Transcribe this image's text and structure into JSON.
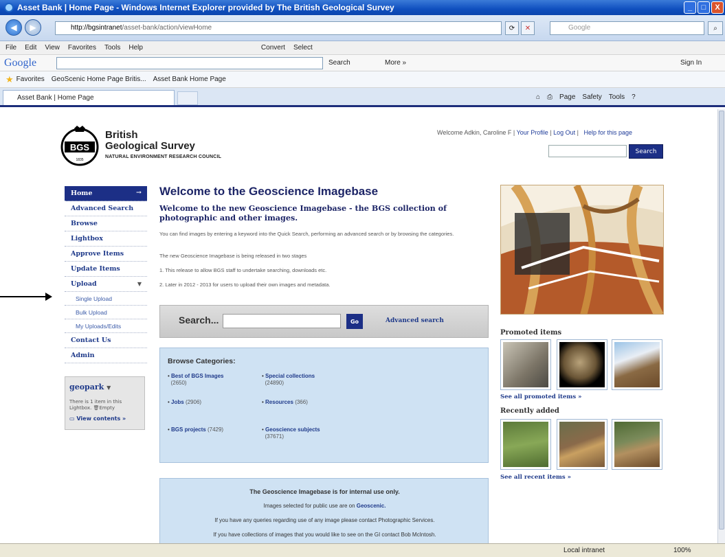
{
  "window": {
    "title": "Asset Bank | Home Page - Windows Internet Explorer provided by The British Geological Survey",
    "buttons": [
      "_",
      "□",
      "X"
    ]
  },
  "address": {
    "url_host": "http://bgsintranet",
    "url_path": "/asset-bank/action/viewHome",
    "search_placeholder": "Google"
  },
  "menu": [
    "File",
    "Edit",
    "View",
    "Favorites",
    "Tools",
    "Help"
  ],
  "menu_extra": [
    "Convert",
    "Select"
  ],
  "google_toolbar": {
    "logo": "Google",
    "search_label": "Search",
    "more_label": "More »",
    "sign_in": "Sign In"
  },
  "favorites": {
    "label": "Favorites",
    "items": [
      "GeoScenic Home Page Britis...",
      "Asset Bank Home Page"
    ]
  },
  "tab": {
    "title": "Asset Bank | Home Page",
    "commands": [
      "Page",
      "Safety",
      "Tools"
    ]
  },
  "header": {
    "brand_line1": "British",
    "brand_line2": "Geological Survey",
    "brand_line3": "NATURAL ENVIRONMENT RESEARCH COUNCIL",
    "logo_text": "BGS",
    "logo_year": "1835",
    "welcome": "Welcome Adkin, Caroline F",
    "your_profile": "Your Profile",
    "log_out": "Log Out",
    "help": "Help for this page",
    "search_button": "Search"
  },
  "nav": {
    "items": [
      {
        "label": "Home",
        "type": "active"
      },
      {
        "label": "Advanced Search",
        "type": "item"
      },
      {
        "label": "Browse",
        "type": "item"
      },
      {
        "label": "Lightbox",
        "type": "item"
      },
      {
        "label": "Approve Items",
        "type": "item"
      },
      {
        "label": "Update Items",
        "type": "item"
      },
      {
        "label": "Upload",
        "type": "item"
      },
      {
        "label": "Single Upload",
        "type": "sub"
      },
      {
        "label": "Bulk Upload",
        "type": "sub"
      },
      {
        "label": "My Uploads/Edits",
        "type": "sub"
      },
      {
        "label": "Contact Us",
        "type": "item"
      },
      {
        "label": "Admin",
        "type": "item"
      }
    ]
  },
  "lightbox": {
    "title": "geopark",
    "text": "There is 1 item in this Lightbox.",
    "empty": "Empty",
    "view": "View contents »"
  },
  "main": {
    "title": "Welcome to the Geoscience Imagebase",
    "subtitle": "Welcome to the new Geoscience Imagebase - the BGS collection of photographic and other images.",
    "para1": "You can find images by entering a keyword into the Quick Search, performing an advanced search or by browsing the categories.",
    "para2": "The new Geoscience Imagebase is being released in two stages",
    "para3": "1. This release to allow BGS staff to undertake searching, downloads etc.",
    "para4": "2. Later in 2012 - 2013 for users to upload their own images and metadata."
  },
  "search": {
    "label": "Search...",
    "go": "Go",
    "advanced": "Advanced search"
  },
  "categories": {
    "title": "Browse Categories:",
    "items": [
      {
        "name": "Best of BGS Images",
        "count": "(2650)"
      },
      {
        "name": "Special collections",
        "count": "(24890)"
      },
      {
        "name": "Jobs",
        "count": "(2906)"
      },
      {
        "name": "Resources",
        "count": "(366)"
      },
      {
        "name": "BGS projects",
        "count": "(7429)"
      },
      {
        "name": "Geoscience subjects",
        "count": "(37671)"
      }
    ]
  },
  "info": {
    "line1": "The Geoscience Imagebase is for internal use only.",
    "line2_pre": "Images selected for public use are on",
    "line2_link": "Geoscenic.",
    "line3": "If you have any queries regarding use of any image please contact Photographic Services.",
    "line4": "If you have collections of images that you would like to see on the GI contact Bob McIntosh."
  },
  "right": {
    "promoted_title": "Promoted items",
    "promoted_link": "See all promoted items »",
    "recent_title": "Recently added",
    "recent_link": "See all recent items »"
  },
  "status": {
    "zone": "Local intranet",
    "zoom": "100%"
  }
}
